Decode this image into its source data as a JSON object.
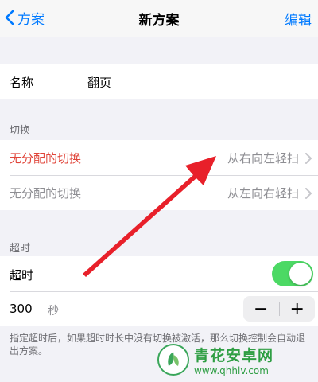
{
  "nav": {
    "back_label": "方案",
    "title": "新方案",
    "edit_label": "编辑"
  },
  "name_row": {
    "label": "名称",
    "value": "翻页"
  },
  "switch_section": {
    "header": "切换",
    "rows": [
      {
        "label": "无分配的切换",
        "detail": "从右向左轻扫",
        "label_color": "#e0453a"
      },
      {
        "label": "无分配的切换",
        "detail": "从左向右轻扫",
        "label_color": "#8e8e93"
      }
    ]
  },
  "timeout_section": {
    "header": "超时",
    "toggle_label": "超时",
    "toggle_on": true,
    "value": "300",
    "unit": "秒",
    "minus": "−",
    "plus": "+"
  },
  "footer_note": "指定超时后，如果超时时长中没有切换被激活，那么切换控制会自动退出方案。",
  "watermark": {
    "title": "青花安卓网",
    "url": "www.qhhlv.com"
  },
  "colors": {
    "accent": "#007aff",
    "toggle_on": "#4cd964",
    "arrow": "#e8202a",
    "highlight": "#e0453a"
  }
}
